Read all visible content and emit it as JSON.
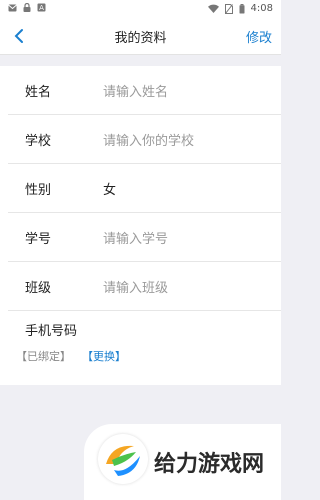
{
  "status_bar": {
    "time": "4:08"
  },
  "header": {
    "title": "我的资料",
    "edit_label": "修改"
  },
  "form": {
    "name": {
      "label": "姓名",
      "placeholder": "请输入姓名"
    },
    "school": {
      "label": "学校",
      "placeholder": "请输入你的学校"
    },
    "gender": {
      "label": "性别",
      "value": "女"
    },
    "student_id": {
      "label": "学号",
      "placeholder": "请输入学号"
    },
    "class": {
      "label": "班级",
      "placeholder": "请输入班级"
    },
    "phone": {
      "label": "手机号码",
      "bound_label": "【已绑定】",
      "change_label": "【更换】"
    }
  },
  "watermark": {
    "text": "给力游戏网"
  },
  "colors": {
    "accent": "#1a7fcf",
    "background": "#efeff4"
  }
}
